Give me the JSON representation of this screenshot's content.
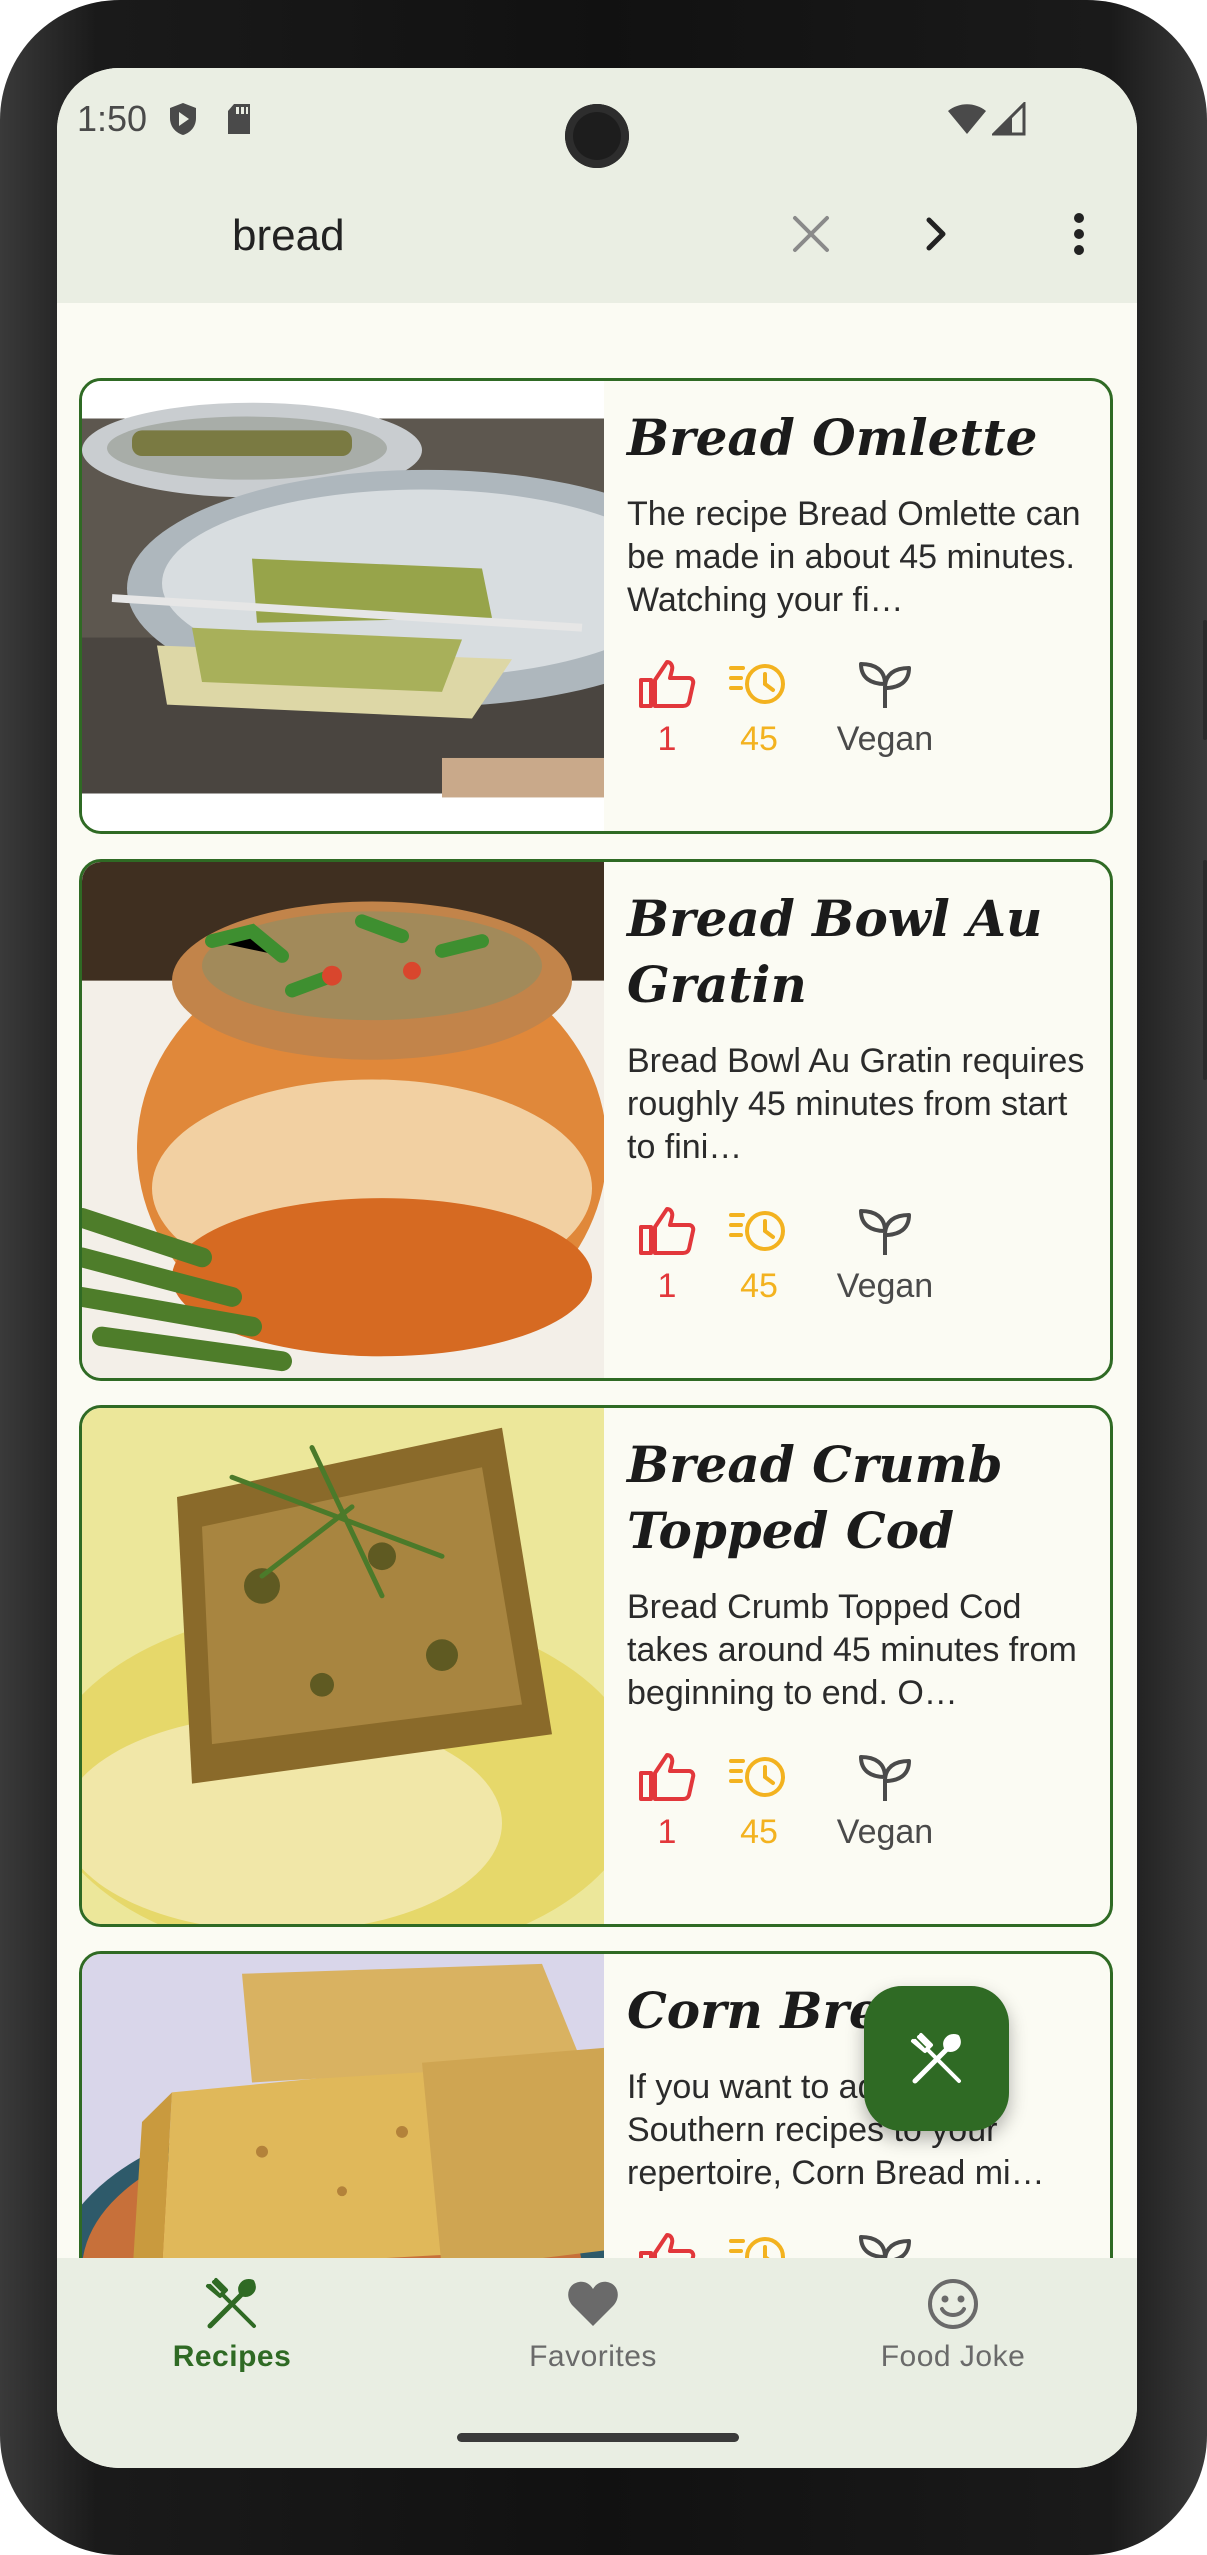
{
  "status_bar": {
    "time": "1:50",
    "icons": [
      "shield-icon",
      "sd-card-icon",
      "wifi-icon",
      "signal-icon"
    ]
  },
  "search": {
    "query": "bread",
    "icons": [
      "close-icon",
      "chevron-right-icon",
      "more-vert-icon"
    ]
  },
  "recipes": [
    {
      "title": "Bread Omlette",
      "description": "The recipe Bread Omlette can be made in about 45 minutes. Watching your fi…",
      "likes": "1",
      "minutes": "45",
      "diet": "Vegan"
    },
    {
      "title": "Bread Bowl Au Gratin",
      "description": "Bread Bowl Au Gratin requires roughly 45 minutes from start to fini…",
      "likes": "1",
      "minutes": "45",
      "diet": "Vegan"
    },
    {
      "title": "Bread Crumb Topped Cod",
      "description": "Bread Crumb Topped Cod takes around 45 minutes from beginning to end. O…",
      "likes": "1",
      "minutes": "45",
      "diet": "Vegan"
    },
    {
      "title": "Corn Bread",
      "description": "If you want to add more Southern recipes to your repertoire, Corn Bread mi…",
      "likes": "",
      "minutes": "",
      "diet": ""
    }
  ],
  "bottom_nav": {
    "items": [
      {
        "label": "Recipes",
        "icon": "fork-knife-icon",
        "selected": true
      },
      {
        "label": "Favorites",
        "icon": "heart-icon",
        "selected": false
      },
      {
        "label": "Food Joke",
        "icon": "smiley-icon",
        "selected": false
      }
    ]
  },
  "colors": {
    "primary": "#2f6a24",
    "like": "#e2373b",
    "time": "#f3b21f",
    "vegan_inactive": "#4a4a4a",
    "surface": "#fbfbf3",
    "bar": "#eaeee3"
  }
}
